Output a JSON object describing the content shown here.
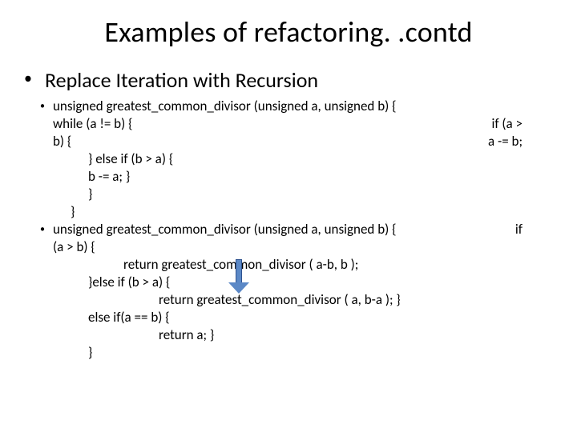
{
  "title": "Examples of refactoring. .contd",
  "subheading": "Replace Iteration with Recursion",
  "block1": {
    "line1": "unsigned greatest_common_divisor (unsigned a, unsigned b) {",
    "line2": "while (a != b) {",
    "line3": "b) {",
    "right1": "if (a >",
    "right2": "a -= b;",
    "line4": "} else if (b > a) {",
    "line5": "  b -= a; }",
    "line6": "}",
    "line7": "}"
  },
  "block2": {
    "line1": "unsigned greatest_common_divisor (unsigned a, unsigned b) {",
    "right1": "if",
    "line2": "(a > b) {",
    "line3": "return greatest_common_divisor ( a-b, b );",
    "line4": "}else if (b > a) {",
    "line5": "return greatest_common_divisor ( a, b-a ); }",
    "line6": "else if(a == b) {",
    "line7": "return a; }",
    "line8": "}"
  }
}
